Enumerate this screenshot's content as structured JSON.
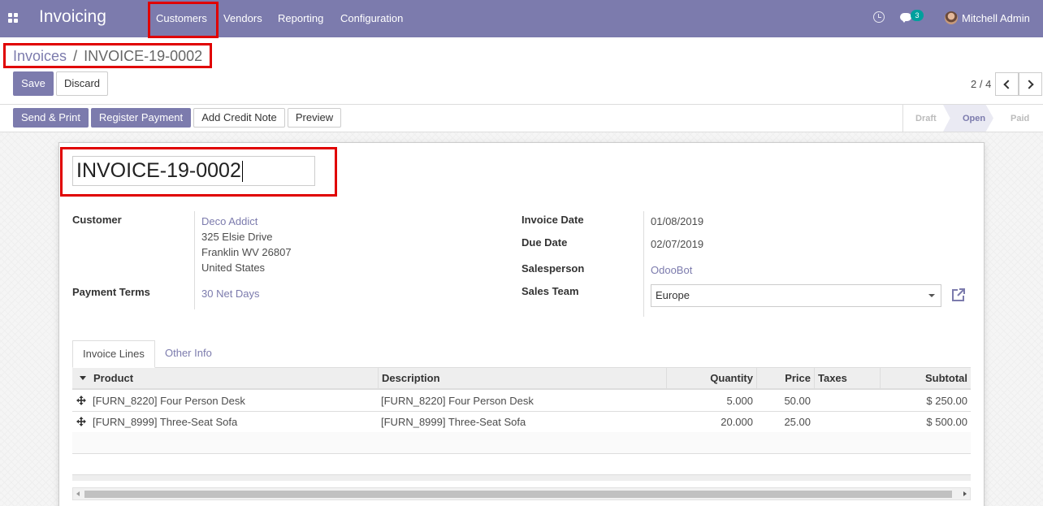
{
  "navbar": {
    "app_title": "Invoicing",
    "menu": [
      "Customers",
      "Vendors",
      "Reporting",
      "Configuration"
    ],
    "chat_count": "3",
    "user_name": "Mitchell Admin",
    "color": "#7c7bad"
  },
  "breadcrumb": {
    "parent": "Invoices",
    "separator": "/",
    "current": "INVOICE-19-0002"
  },
  "control": {
    "save_label": "Save",
    "discard_label": "Discard",
    "pager": "2 / 4"
  },
  "statusbar": {
    "buttons": [
      "Send & Print",
      "Register Payment",
      "Add Credit Note",
      "Preview"
    ],
    "steps": [
      "Draft",
      "Open",
      "Paid"
    ],
    "current_step": "Open"
  },
  "form": {
    "title_value": "INVOICE-19-0002",
    "customer_label": "Customer",
    "customer_name": "Deco Addict",
    "customer_address": [
      "325 Elsie Drive",
      "Franklin WV 26807",
      "United States"
    ],
    "payment_terms_label": "Payment Terms",
    "payment_terms": "30 Net Days",
    "invoice_date_label": "Invoice Date",
    "invoice_date": "01/08/2019",
    "due_date_label": "Due Date",
    "due_date": "02/07/2019",
    "salesperson_label": "Salesperson",
    "salesperson": "OdooBot",
    "sales_team_label": "Sales Team",
    "sales_team": "Europe"
  },
  "tabs": [
    "Invoice Lines",
    "Other Info"
  ],
  "lines": {
    "columns": [
      "Product",
      "Description",
      "Quantity",
      "Price",
      "Taxes",
      "Subtotal"
    ],
    "rows": [
      {
        "product": "[FURN_8220] Four Person Desk",
        "description": "[FURN_8220] Four Person Desk",
        "quantity": "5.000",
        "price": "50.00",
        "taxes": "",
        "subtotal": "$ 250.00"
      },
      {
        "product": "[FURN_8999] Three-Seat Sofa",
        "description": "[FURN_8999] Three-Seat Sofa",
        "quantity": "20.000",
        "price": "25.00",
        "taxes": "",
        "subtotal": "$ 500.00"
      }
    ]
  },
  "annotation_color": "#e00000"
}
